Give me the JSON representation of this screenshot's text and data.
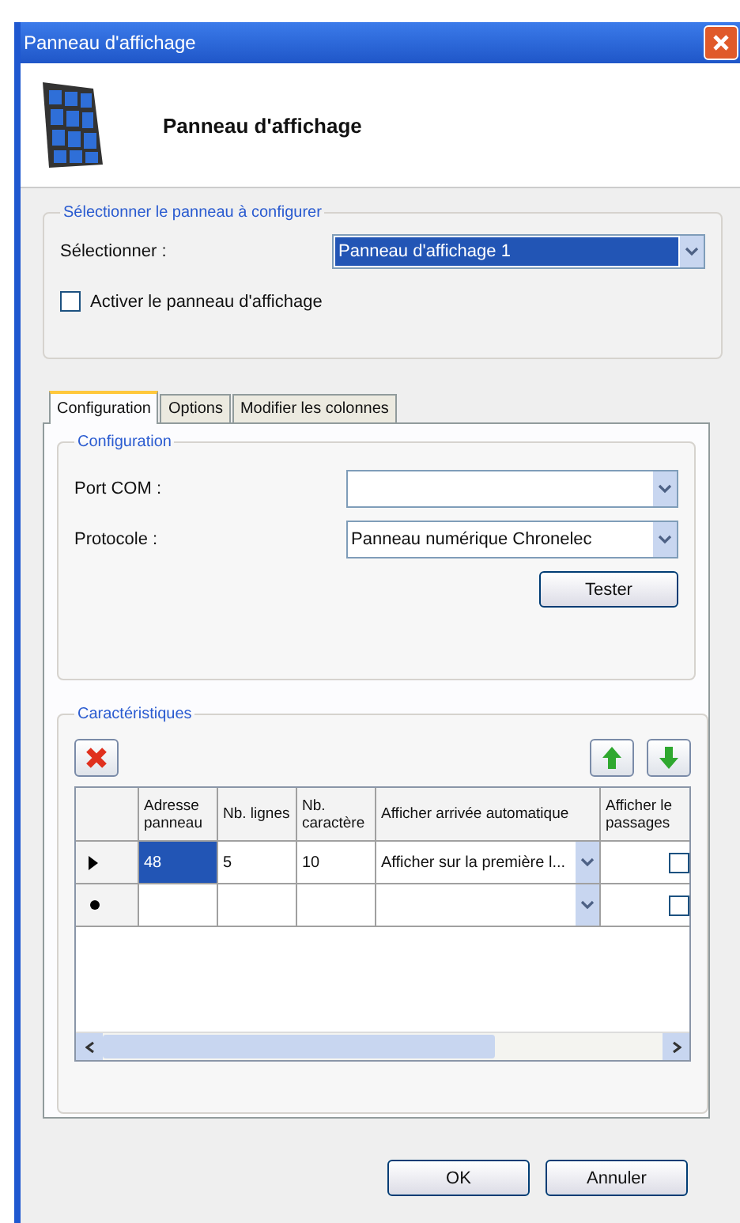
{
  "window": {
    "title": "Panneau d'affichage"
  },
  "header": {
    "title": "Panneau d'affichage"
  },
  "panel_group": {
    "legend": "Sélectionner le panneau à configurer",
    "select_label": "Sélectionner :",
    "select_value": "Panneau d'affichage 1",
    "activate": {
      "label": "Activer le panneau d'affichage",
      "checked": false
    }
  },
  "tabs": [
    {
      "label": "Configuration",
      "selected": true
    },
    {
      "label": "Options",
      "selected": false
    },
    {
      "label": "Modifier les colonnes",
      "selected": false
    }
  ],
  "configuration": {
    "legend": "Configuration",
    "port_label": "Port COM :",
    "protocol_label": "Protocole :",
    "protocol_value": "Panneau numérique Chronelec",
    "test_button": "Tester"
  },
  "characteristics": {
    "legend": "Caractéristiques",
    "table": {
      "columns": [
        "Adresse panneau",
        "Nb. lignes",
        "Nb. caractère",
        "Afficher arrivée automatique",
        "Afficher le passages"
      ],
      "rows": [
        {
          "kind": "current",
          "address": "48",
          "address_selected": true,
          "lines": "5",
          "chars": "10",
          "auto": "Afficher sur la première l...",
          "passages_checked": false
        },
        {
          "kind": "new",
          "address": "",
          "address_selected": false,
          "lines": "",
          "chars": "",
          "auto": "",
          "passages_checked": false
        }
      ]
    }
  },
  "buttons": [
    "OK",
    "Annuler"
  ]
}
